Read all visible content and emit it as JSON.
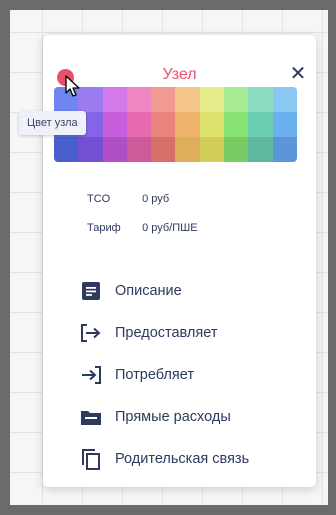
{
  "node": {
    "title": "Узел",
    "close_icon": "close-icon",
    "tooltip": "Цвет узла",
    "selected_color": "#e8506a"
  },
  "palette": {
    "rows": [
      [
        "#6f86f0",
        "#9a7cf0",
        "#d479ea",
        "#ee86c4",
        "#f19a92",
        "#f3c58a",
        "#e5ec8c",
        "#a8ec92",
        "#8edcc4",
        "#88c8f2"
      ],
      [
        "#566fe3",
        "#8664e7",
        "#c75edd",
        "#e66aaf",
        "#e9847c",
        "#eeb26b",
        "#dde26c",
        "#89e274",
        "#6ccfb1",
        "#69b0ec"
      ],
      [
        "#4a5fcc",
        "#744fd1",
        "#b04fc5",
        "#cf5a9a",
        "#d86e68",
        "#deae5a",
        "#cfcd58",
        "#7acb64",
        "#5fb9a0",
        "#5a96d9"
      ]
    ]
  },
  "info": {
    "tco_label": "TCO",
    "tco_value": "0 руб",
    "tariff_label": "Тариф",
    "tariff_value": "0 руб/ПШЕ"
  },
  "menu": [
    {
      "label": "Описание",
      "icon": "description-icon"
    },
    {
      "label": "Предоставляет",
      "icon": "provides-icon"
    },
    {
      "label": "Потребляет",
      "icon": "consumes-icon"
    },
    {
      "label": "Прямые расходы",
      "icon": "folder-icon"
    },
    {
      "label": "Родительская связь",
      "icon": "copy-icon"
    }
  ],
  "colors": {
    "accent": "#e8506a",
    "text": "#2d3a5e"
  }
}
